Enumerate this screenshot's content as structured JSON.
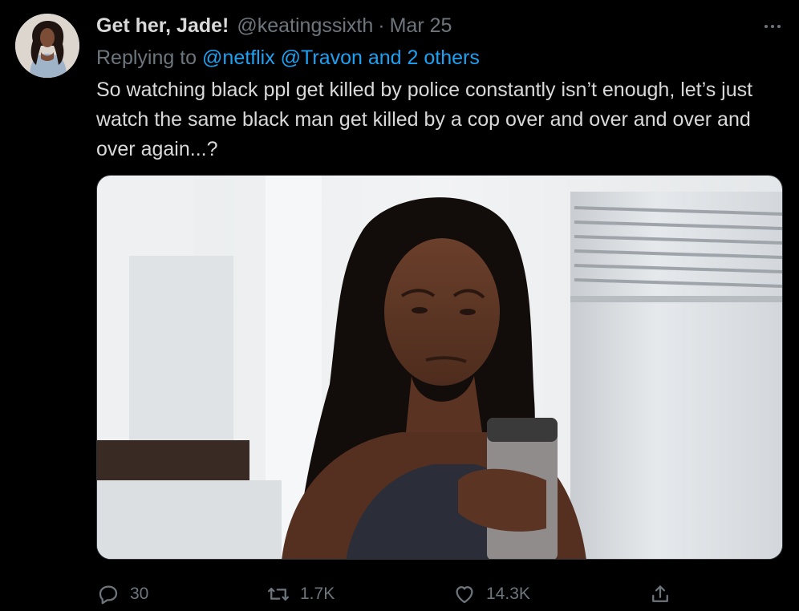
{
  "tweet": {
    "display_name": "Get her, Jade!",
    "handle": "@keatingssixth",
    "separator": "·",
    "date": "Mar 25",
    "reply": {
      "prefix": "Replying to",
      "mentions": [
        "@netflix",
        "@Travon and 2 others"
      ]
    },
    "text": "So watching black ppl get killed by police constantly isn’t enough, let’s just watch the same black man get killed by a cop over and over and over and over again...?",
    "actions": {
      "reply_count": "30",
      "retweet_count": "1.7K",
      "like_count": "14.3K"
    }
  },
  "icons": {
    "more": "more-horizontal-icon",
    "reply": "reply-bubble-icon",
    "retweet": "retweet-icon",
    "like": "heart-icon",
    "share": "share-upload-icon"
  },
  "colors": {
    "background": "#000000",
    "text_primary": "#d9d9d9",
    "text_secondary": "#6e767d",
    "link": "#1da1f2"
  }
}
